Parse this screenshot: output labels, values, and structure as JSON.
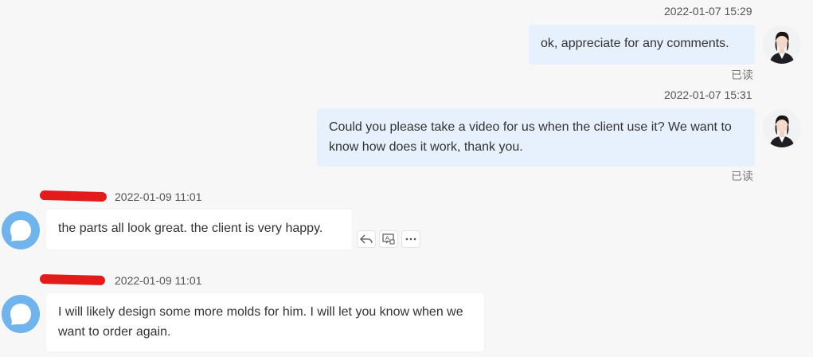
{
  "messages": [
    {
      "direction": "outgoing",
      "timestamp": "2022-01-07 15:29",
      "text": "ok, appreciate for any comments.",
      "status": "已读"
    },
    {
      "direction": "outgoing",
      "timestamp": "2022-01-07 15:31",
      "text": "Could you please take a video for us when the client use it? We want to know how does it work, thank you.",
      "status": "已读"
    },
    {
      "direction": "incoming",
      "sender_redacted": true,
      "timestamp": "2022-01-09 11:01",
      "text": "the parts all look great. the client is very happy.",
      "actions": [
        "reply-icon",
        "translate-icon",
        "more-icon"
      ]
    },
    {
      "direction": "incoming",
      "sender_redacted": true,
      "timestamp": "2022-01-09 11:01",
      "text": "I will likely design some more molds for him. I will let you know when we want to order again."
    }
  ],
  "colors": {
    "outgoing_bubble": "#e6f1fd",
    "incoming_bubble": "#ffffff",
    "background": "#f7f7f8",
    "redaction": "#e41b1b",
    "other_avatar": "#6fb4ec"
  }
}
